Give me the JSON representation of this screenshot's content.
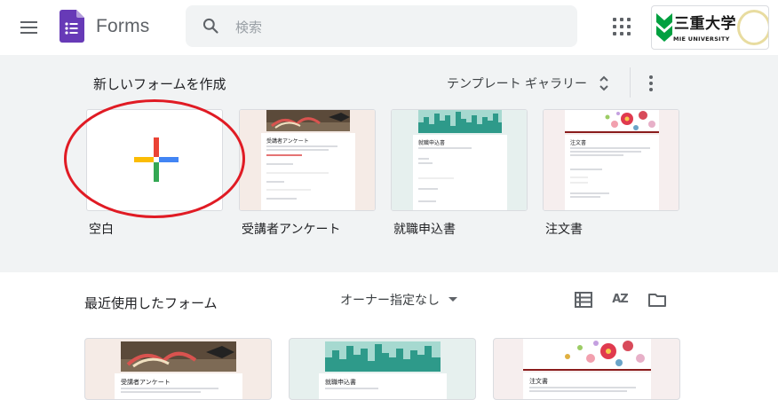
{
  "app": {
    "title": "Forms"
  },
  "search": {
    "placeholder": "検索"
  },
  "account": {
    "org_name": "三重大学",
    "org_sub": "MIE UNIVERSITY"
  },
  "templates": {
    "section_title": "新しいフォームを作成",
    "gallery_label": "テンプレート ギャラリー",
    "items": [
      {
        "label": "空白"
      },
      {
        "label": "受講者アンケート",
        "preview_title": "受講者アンケート"
      },
      {
        "label": "就職申込書",
        "preview_title": "就職申込書"
      },
      {
        "label": "注文書",
        "preview_title": "注文書"
      }
    ]
  },
  "recent": {
    "section_title": "最近使用したフォーム",
    "owner_filter": "オーナー指定なし",
    "sort_icon_label": "AZ",
    "cards": [
      {
        "preview_title": "受講者アンケート"
      },
      {
        "preview_title": "就職申込書"
      },
      {
        "preview_title": "注文書"
      }
    ]
  },
  "colors": {
    "forms_purple": "#673ab7",
    "plus_red": "#ea4335",
    "plus_blue": "#4285f4",
    "plus_yellow": "#fbbc04",
    "plus_green": "#34a853",
    "univ_green": "#00a040",
    "annotation_red": "#e01b24"
  },
  "icons": [
    "menu-icon",
    "forms-logo-icon",
    "search-icon",
    "apps-grid-icon",
    "more-vert-icon",
    "unfold-icon",
    "dropdown-arrow-icon",
    "list-view-icon",
    "sort-az-icon",
    "folder-icon"
  ]
}
